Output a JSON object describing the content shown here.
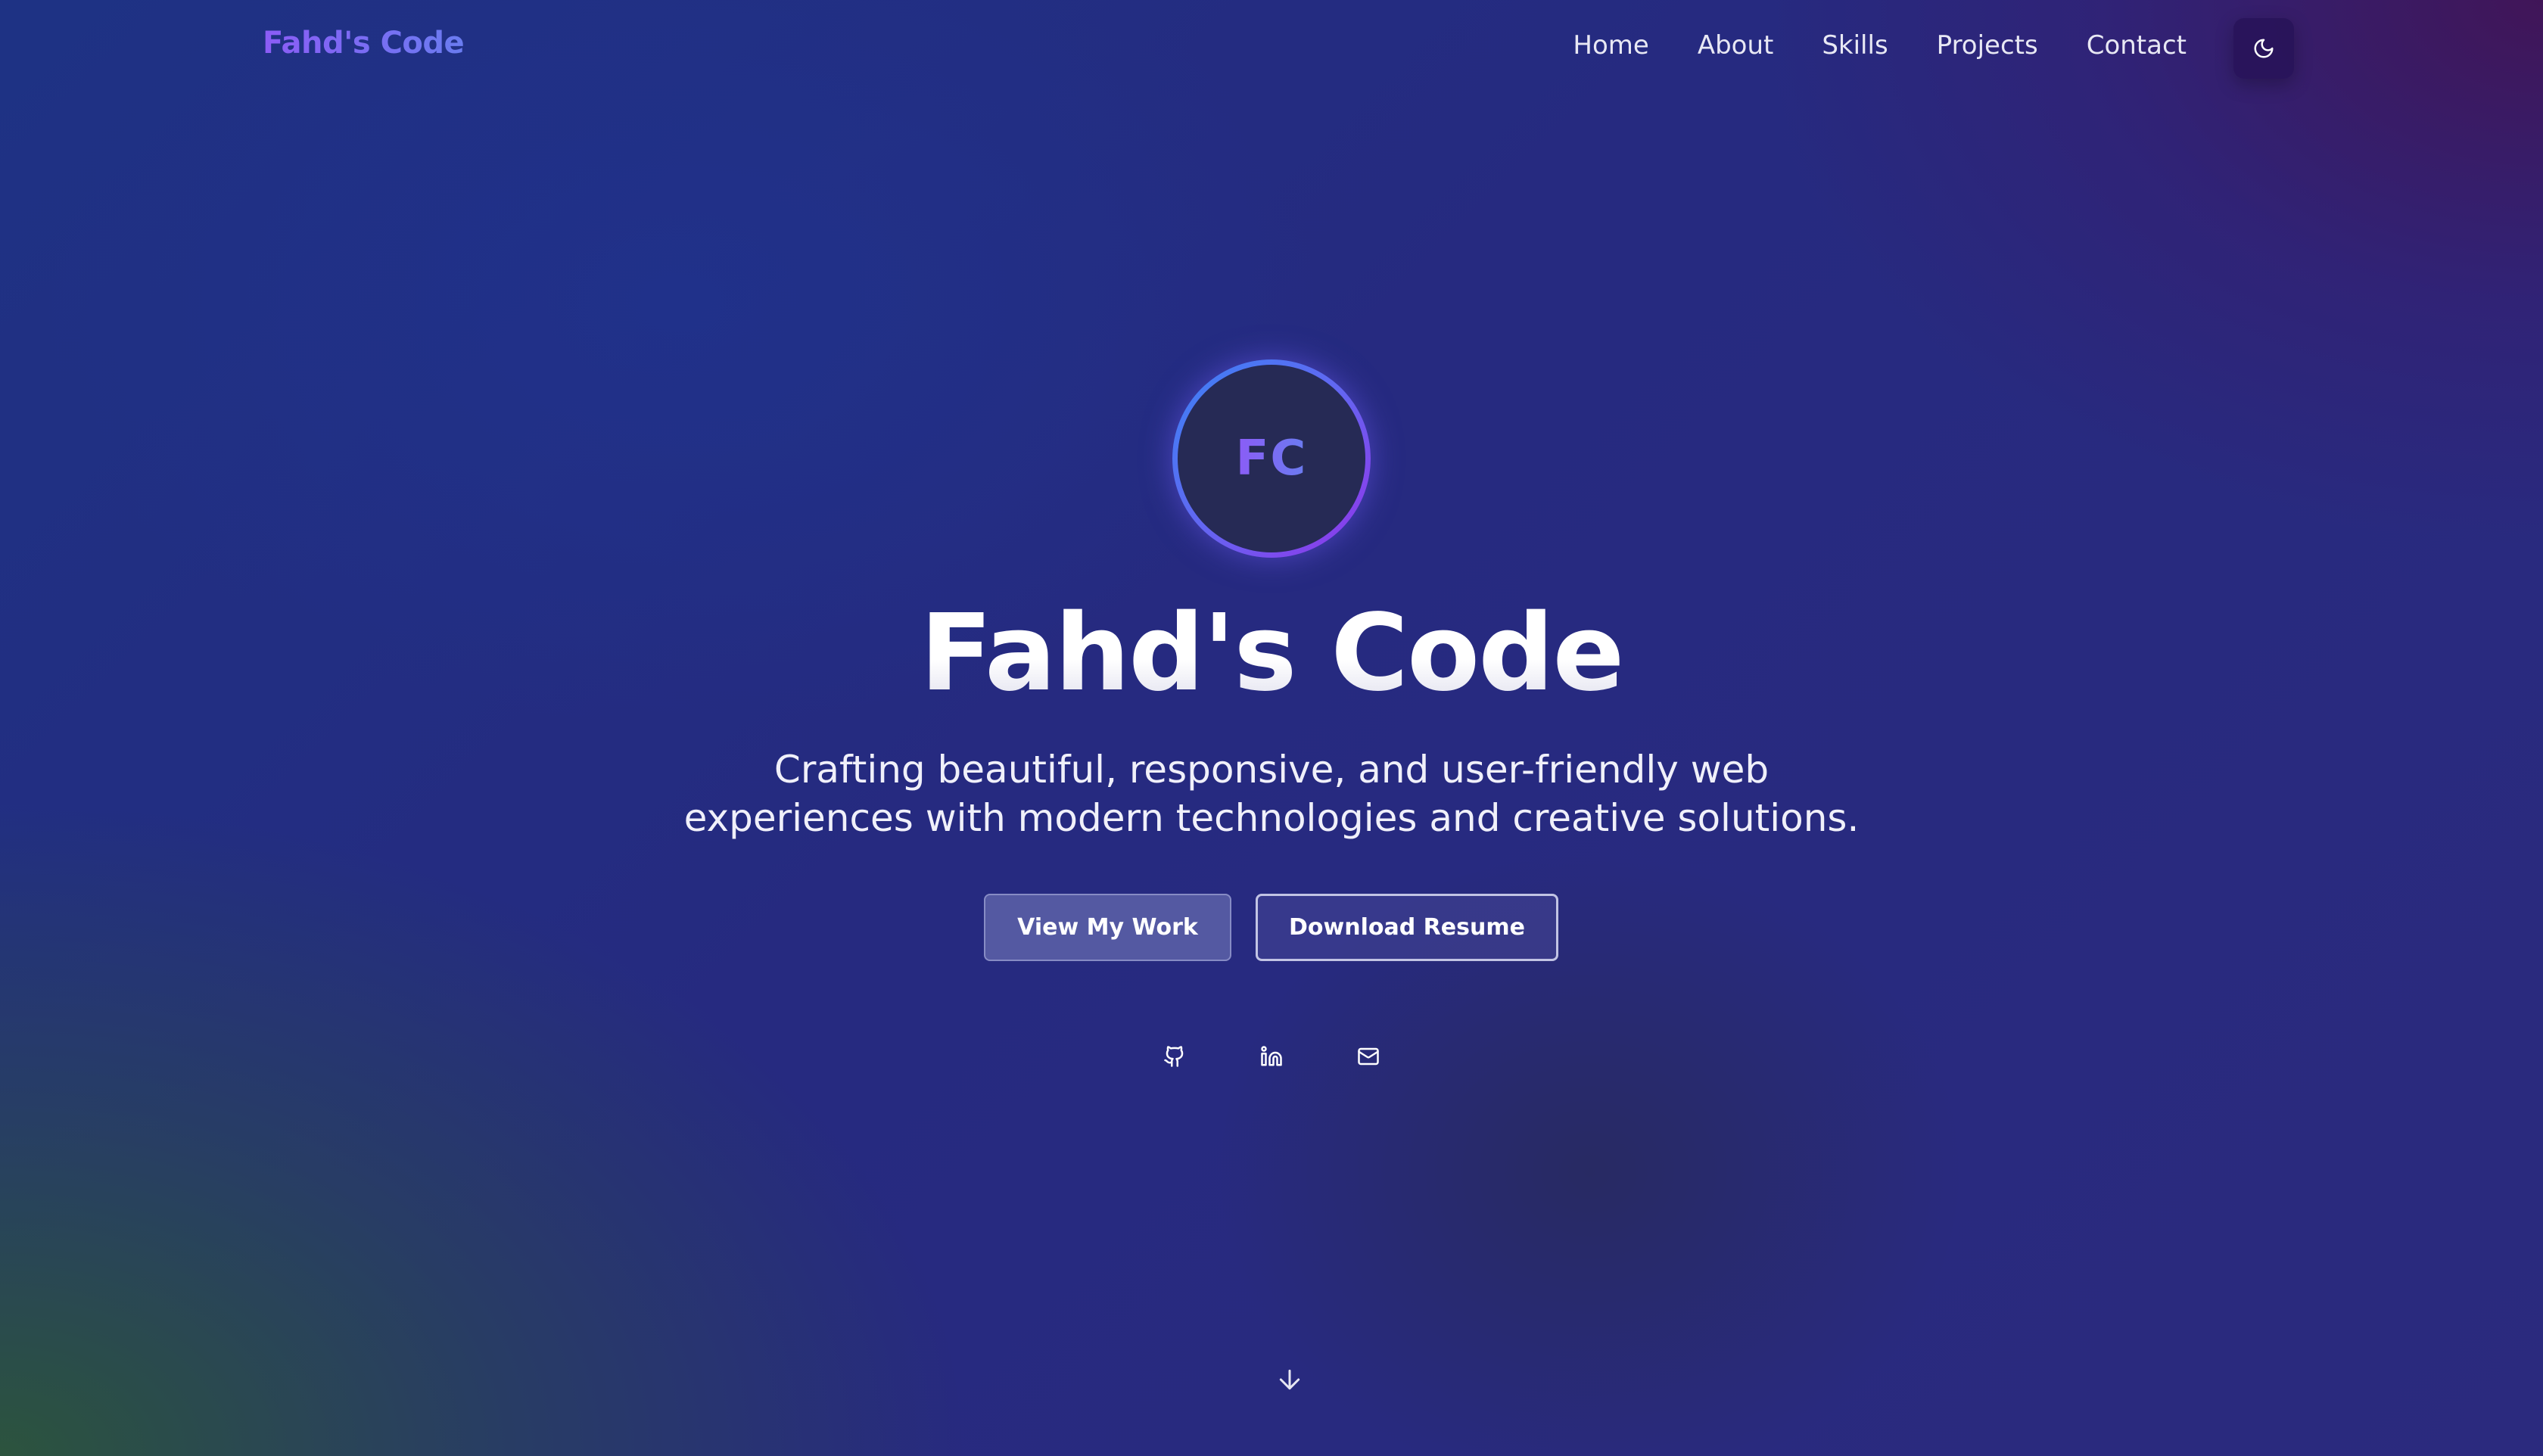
{
  "nav": {
    "logo": "Fahd's Code",
    "links": [
      "Home",
      "About",
      "Skills",
      "Projects",
      "Contact"
    ],
    "theme_toggle_icon": "moon-icon"
  },
  "hero": {
    "avatar_initials": "FC",
    "title": "Fahd's Code",
    "subtitle": "Crafting beautiful, responsive, and user-friendly web experiences with modern technologies and creative solutions.",
    "primary_button": "View My Work",
    "secondary_button": "Download Resume",
    "social_icons": [
      "github-icon",
      "linkedin-icon",
      "mail-icon"
    ],
    "scroll_icon": "arrow-down-icon"
  },
  "colors": {
    "accent_purple": "#8b5cf6",
    "accent_blue": "#6a7cf0",
    "bg_blue": "#1e3284"
  }
}
